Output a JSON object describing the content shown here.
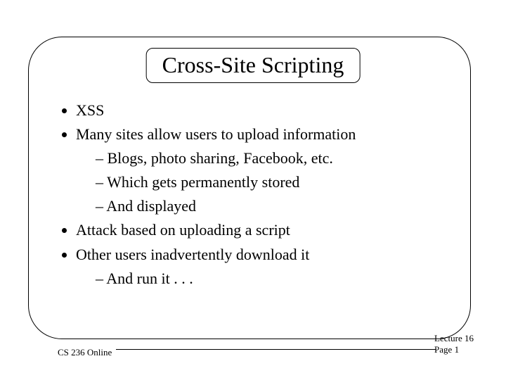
{
  "title": "Cross-Site Scripting",
  "bullets": {
    "b1": "XSS",
    "b2": "Many sites allow users to upload information",
    "b2a": "Blogs, photo sharing, Facebook, etc.",
    "b2b": "Which gets permanently stored",
    "b2c": "And displayed",
    "b3": "Attack based on uploading a script",
    "b4": "Other users inadvertently download it",
    "b4a": "And run it . . ."
  },
  "footer": {
    "left": "CS 236 Online",
    "lecture": "Lecture 16",
    "page": "Page 1"
  }
}
